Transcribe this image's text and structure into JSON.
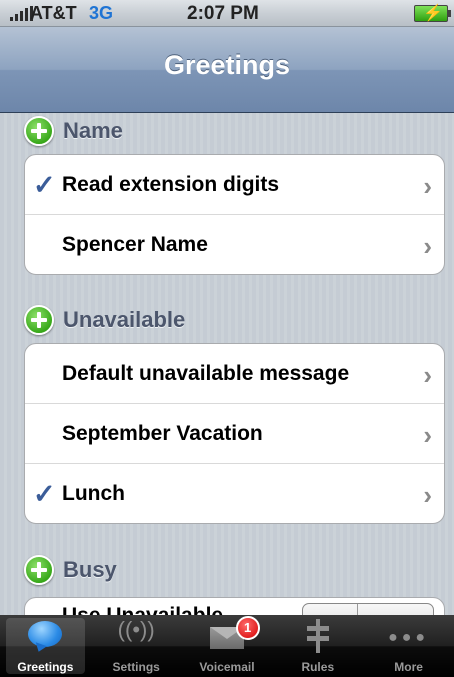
{
  "status_bar": {
    "carrier": "AT&T",
    "network": "3G",
    "time": "2:07 PM"
  },
  "nav": {
    "title": "Greetings"
  },
  "sections": [
    {
      "title": "Name",
      "rows": [
        {
          "label": "Read extension digits",
          "checked": true
        },
        {
          "label": "Spencer Name",
          "checked": false
        }
      ]
    },
    {
      "title": "Unavailable",
      "rows": [
        {
          "label": "Default unavailable message",
          "checked": false
        },
        {
          "label": "September Vacation",
          "checked": false
        },
        {
          "label": "Lunch",
          "checked": true
        }
      ]
    },
    {
      "title": "Busy",
      "rows": [
        {
          "label": "Use Unavailable",
          "checked": false
        }
      ]
    }
  ],
  "icons": {
    "check": "checkmark-icon",
    "chevron": "chevron-right-icon",
    "add": "plus-circle-icon"
  },
  "colors": {
    "add_green": "#39a91b",
    "check_blue": "#3b5d99",
    "nav_blue": "#7d95b6",
    "badge_red": "#d40000"
  },
  "tab_bar": {
    "tabs": [
      {
        "label": "Greetings",
        "icon": "speech-bubble-icon",
        "selected": true
      },
      {
        "label": "Settings",
        "icon": "antenna-icon",
        "selected": false
      },
      {
        "label": "Voicemail",
        "icon": "envelope-icon",
        "selected": false,
        "badge": "1"
      },
      {
        "label": "Rules",
        "icon": "signpost-icon",
        "selected": false
      },
      {
        "label": "More",
        "icon": "more-dots-icon",
        "selected": false
      }
    ]
  }
}
